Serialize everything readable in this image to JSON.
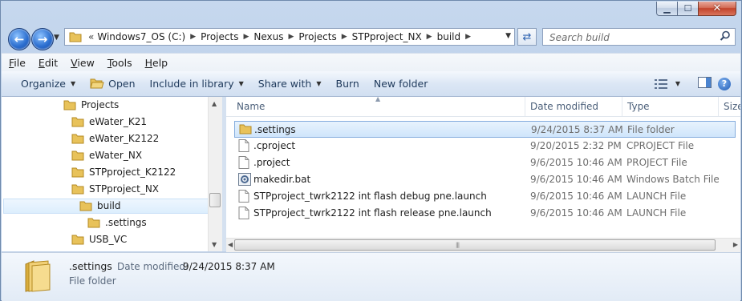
{
  "window": {
    "minimize_glyph": "▁",
    "maximize_glyph": "☐",
    "close_glyph": "✕"
  },
  "address": {
    "overflow": "«",
    "crumbs": [
      "Windows7_OS (C:)",
      "Projects",
      "Nexus",
      "Projects",
      "STPproject_NX",
      "build"
    ]
  },
  "search": {
    "placeholder": "Search build"
  },
  "menu": [
    "File",
    "Edit",
    "View",
    "Tools",
    "Help"
  ],
  "menu_underline": [
    "F",
    "E",
    "V",
    "T",
    "H"
  ],
  "commands": {
    "organize": "Organize",
    "open": "Open",
    "include": "Include in library",
    "share": "Share with",
    "burn": "Burn",
    "new_folder": "New folder"
  },
  "tree": [
    {
      "label": "Projects",
      "level": 0
    },
    {
      "label": "eWater_K21",
      "level": 1
    },
    {
      "label": "eWater_K2122",
      "level": 1
    },
    {
      "label": "eWater_NX",
      "level": 1
    },
    {
      "label": "STPproject_K2122",
      "level": 1
    },
    {
      "label": "STPproject_NX",
      "level": 1
    },
    {
      "label": "build",
      "level": 2,
      "selected": true
    },
    {
      "label": ".settings",
      "level": 3
    },
    {
      "label": "USB_VC",
      "level": 1
    }
  ],
  "columns": {
    "name": "Name",
    "date": "Date modified",
    "type": "Type",
    "size": "Size"
  },
  "files": [
    {
      "name": ".settings",
      "date": "9/24/2015 8:37 AM",
      "type": "File folder",
      "icon": "folder-icon",
      "selected": true
    },
    {
      "name": ".cproject",
      "date": "9/20/2015 2:32 PM",
      "type": "CPROJECT File",
      "icon": "file-icon"
    },
    {
      "name": ".project",
      "date": "9/6/2015 10:46 AM",
      "type": "PROJECT File",
      "icon": "file-icon"
    },
    {
      "name": "makedir.bat",
      "date": "9/6/2015 10:46 AM",
      "type": "Windows Batch File",
      "icon": "batch-file-icon"
    },
    {
      "name": "STPproject_twrk2122 int flash debug pne.launch",
      "date": "9/6/2015 10:46 AM",
      "type": "LAUNCH File",
      "icon": "file-icon"
    },
    {
      "name": "STPproject_twrk2122 int flash release pne.launch",
      "date": "9/6/2015 10:46 AM",
      "type": "LAUNCH File",
      "icon": "file-icon"
    }
  ],
  "details": {
    "name": ".settings",
    "date_label": "Date modified:",
    "date_value": "9/24/2015 8:37 AM",
    "type": "File folder"
  },
  "colors": {
    "folder": "#e8c25a",
    "selection": "#cfe5fb",
    "accent": "#2c6fd0"
  }
}
